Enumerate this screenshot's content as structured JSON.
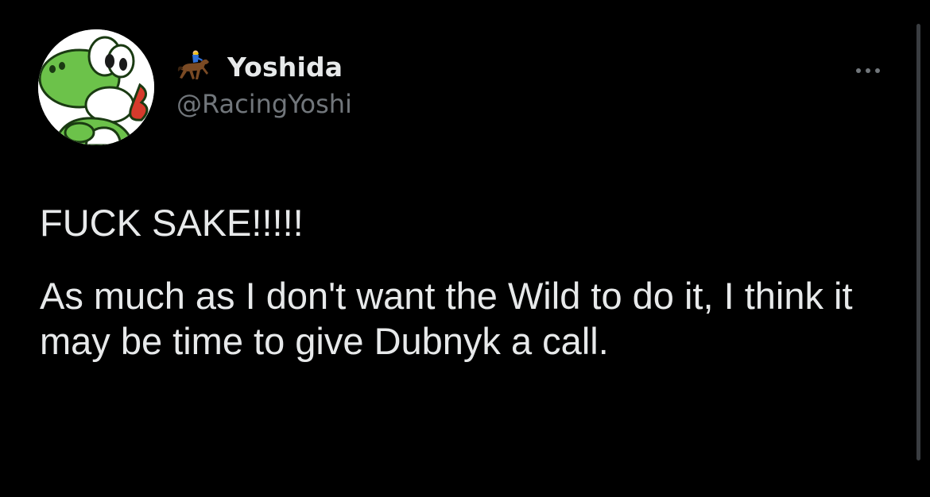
{
  "author": {
    "display_name": "Yoshida",
    "handle": "@RacingYoshi",
    "name_emoji": "horse-racing-emoji"
  },
  "tweet": {
    "paragraphs": [
      "FUCK SAKE!!!!!",
      "As much as I don't want the Wild to do it, I think it may be time to give Dubnyk a call."
    ]
  },
  "icons": {
    "more": "more-options-icon",
    "avatar": "yoshi-avatar"
  },
  "colors": {
    "background": "#000000",
    "primary_text": "#e7e9ea",
    "secondary_text": "#71767b",
    "avatar_green": "#6cc24a"
  }
}
